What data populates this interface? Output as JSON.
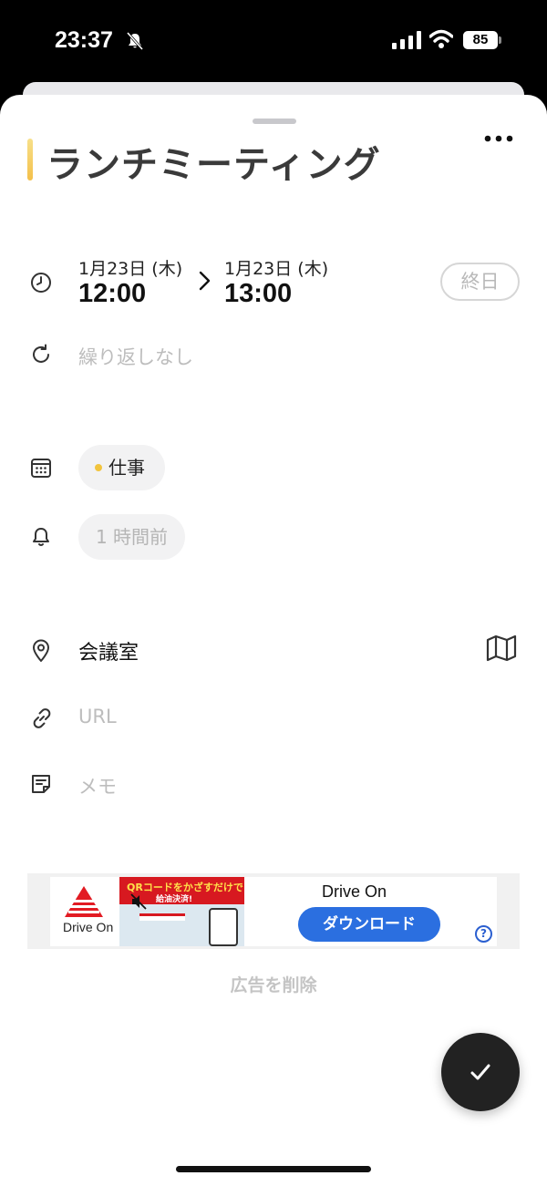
{
  "status_bar": {
    "time": "23:37",
    "battery": "85"
  },
  "event": {
    "title": "ランチミーティング",
    "color": "#f4c04a"
  },
  "schedule": {
    "start_date": "1月23日 (木)",
    "start_time": "12:00",
    "end_date": "1月23日 (木)",
    "end_time": "13:00",
    "all_day_label": "終日"
  },
  "repeat": {
    "placeholder": "繰り返しなし"
  },
  "calendar": {
    "label": "仕事",
    "dot_color": "#f2c43d"
  },
  "reminder": {
    "label": "1 時間前"
  },
  "location": {
    "value": "会議室"
  },
  "url": {
    "placeholder": "URL"
  },
  "memo": {
    "placeholder": "メモ"
  },
  "ad": {
    "logo_text": "Drive On",
    "banner_title": "QRコードをかざすだけで",
    "banner_subtitle": "給油決済!",
    "app_name": "Drive On",
    "download_label": "ダウンロード",
    "help_label": "?"
  },
  "remove_ads_label": "広告を削除",
  "icons": {
    "clock": "clock-icon",
    "repeat": "repeat-icon",
    "calendar": "calendar-icon",
    "bell": "bell-icon",
    "location": "location-pin-icon",
    "map": "map-icon",
    "link": "link-icon",
    "memo": "memo-icon",
    "more": "more-icon",
    "check": "check-icon"
  }
}
